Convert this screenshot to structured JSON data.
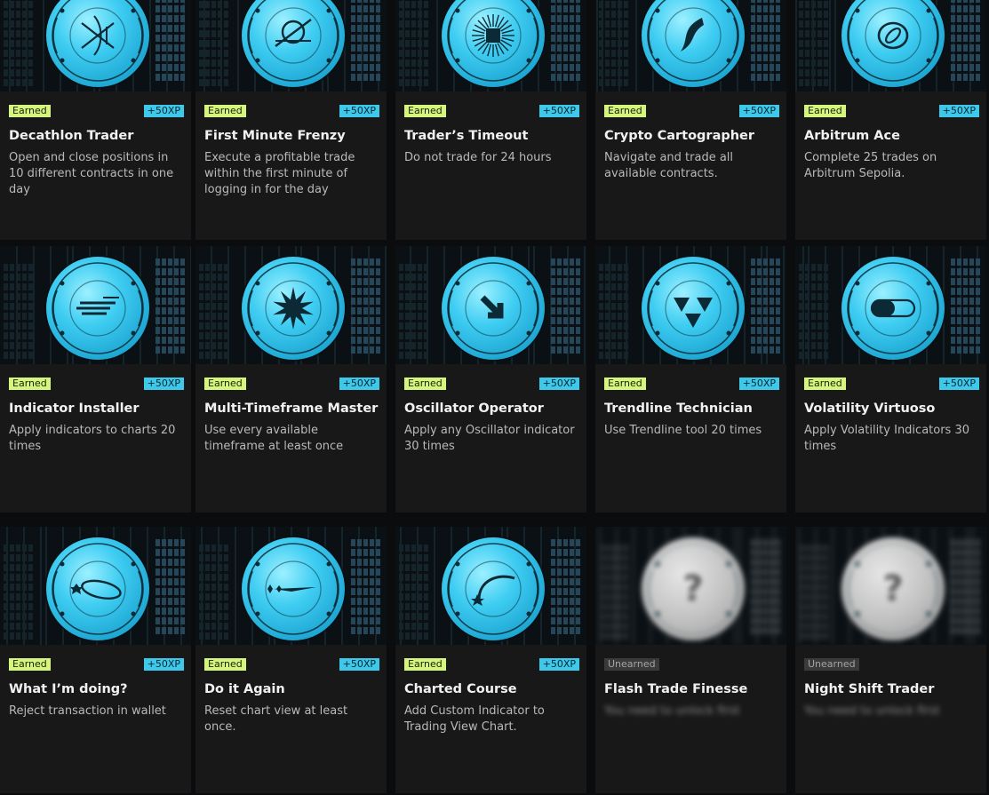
{
  "badges": [
    {
      "title": "Decathlon Trader",
      "description": "Open and close positions in 10 different contracts in one day",
      "status": "Earned",
      "xp": "+50XP",
      "icon": "hourglass-lines-icon"
    },
    {
      "title": "First Minute Frenzy",
      "description": "Execute a profitable trade within the first minute of logging in for the day",
      "status": "Earned",
      "xp": "+50XP",
      "icon": "crossed-circle-icon"
    },
    {
      "title": "Trader’s Timeout",
      "description": "Do not trade for 24 hours",
      "status": "Earned",
      "xp": "+50XP",
      "icon": "sunburst-icon"
    },
    {
      "title": "Crypto Cartographer",
      "description": "Navigate and trade all available contracts.",
      "status": "Earned",
      "xp": "+50XP",
      "icon": "swoosh-icon"
    },
    {
      "title": "Arbitrum Ace",
      "description": "Complete 25 trades on Arbitrum Sepolia.",
      "status": "Earned",
      "xp": "+50XP",
      "icon": "ringed-planet-icon"
    },
    {
      "title": "Indicator Installer",
      "description": "Apply indicators to charts 20 times",
      "status": "Earned",
      "xp": "+50XP",
      "icon": "speed-lines-icon"
    },
    {
      "title": "Multi-Timeframe Master",
      "description": "Use every available timeframe at least once",
      "status": "Earned",
      "xp": "+50XP",
      "icon": "spiky-star-icon"
    },
    {
      "title": "Oscillator Operator",
      "description": "Apply any Oscillator indicator 30 times",
      "status": "Earned",
      "xp": "+50XP",
      "icon": "arrow-down-right-icon"
    },
    {
      "title": "Trendline Technician",
      "description": "Use Trendline tool 20 times",
      "status": "Earned",
      "xp": "+50XP",
      "icon": "triangles-icon"
    },
    {
      "title": "Volatility Virtuoso",
      "description": "Apply Volatility Indicators 30 times",
      "status": "Earned",
      "xp": "+50XP",
      "icon": "toggle-pill-icon"
    },
    {
      "title": "What I’m doing?",
      "description": "Reject transaction in wallet",
      "status": "Earned",
      "xp": "+50XP",
      "icon": "orbit-star-icon"
    },
    {
      "title": "Do it Again",
      "description": "Reset chart view at least once.",
      "status": "Earned",
      "xp": "+50XP",
      "icon": "comet-icon"
    },
    {
      "title": "Charted Course",
      "description": "Add Custom Indicator to Trading View Chart.",
      "status": "Earned",
      "xp": "+50XP",
      "icon": "arc-star-icon"
    },
    {
      "title": "Flash Trade Finesse",
      "description": "You need to unlock first",
      "status": "Unearned",
      "xp": "",
      "icon": "question-mark-icon"
    },
    {
      "title": "Night Shift Trader",
      "description": "You need to unlock first",
      "status": "Unearned",
      "xp": "",
      "icon": "question-mark-icon"
    }
  ],
  "colors": {
    "earned_tag": "#d6f57e",
    "xp_tag": "#3ec8ea",
    "unearned_tag": "#3a3a3a",
    "card_bg": "#181818",
    "medal_cyan": "#47d3f5"
  }
}
